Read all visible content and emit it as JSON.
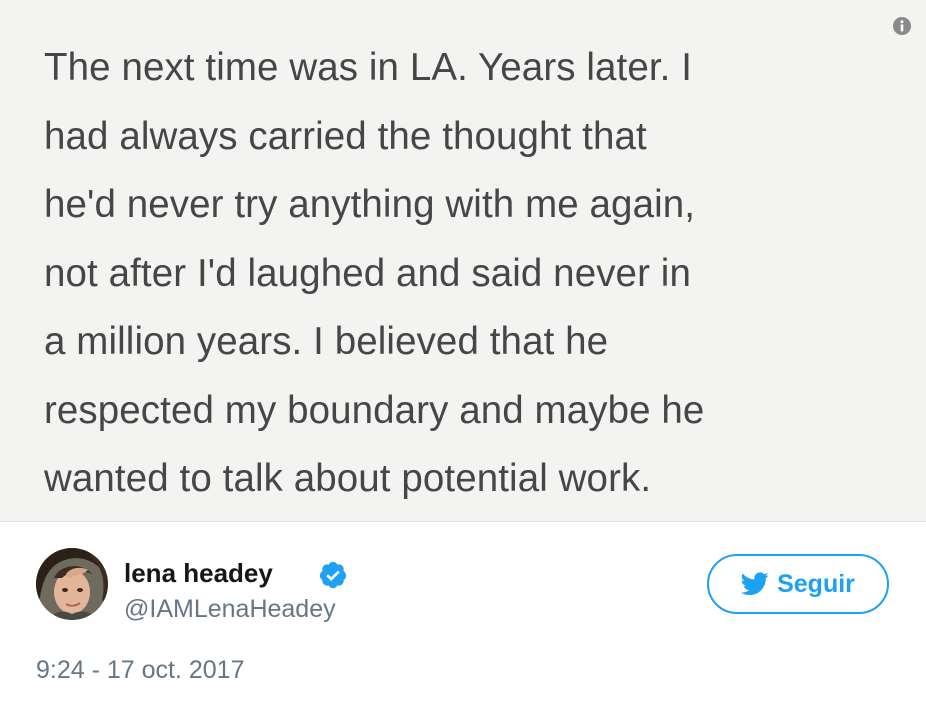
{
  "tweet": {
    "image_text_lines": [
      "The next time was in LA. Years later. I",
      "had always carried the thought that",
      "he'd never try anything with me again,",
      "not after I'd laughed and said never in",
      "a million years. I believed that he",
      "respected my boundary and maybe he",
      "wanted to talk about potential work."
    ],
    "info_icon": "info-icon",
    "author": {
      "display_name": "lena headey",
      "handle": "@IAMLenaHeadey",
      "verified": true,
      "verified_icon": "verified-badge-icon"
    },
    "follow_button": {
      "label": "Seguir",
      "icon": "twitter-bird-icon"
    },
    "timestamp": "9:24 - 17 oct. 2017",
    "colors": {
      "accent": "#1da1f2",
      "secondary_text": "#657786",
      "primary_text": "#14171a",
      "note_background": "#f3f3f2",
      "note_text": "#464646"
    }
  }
}
